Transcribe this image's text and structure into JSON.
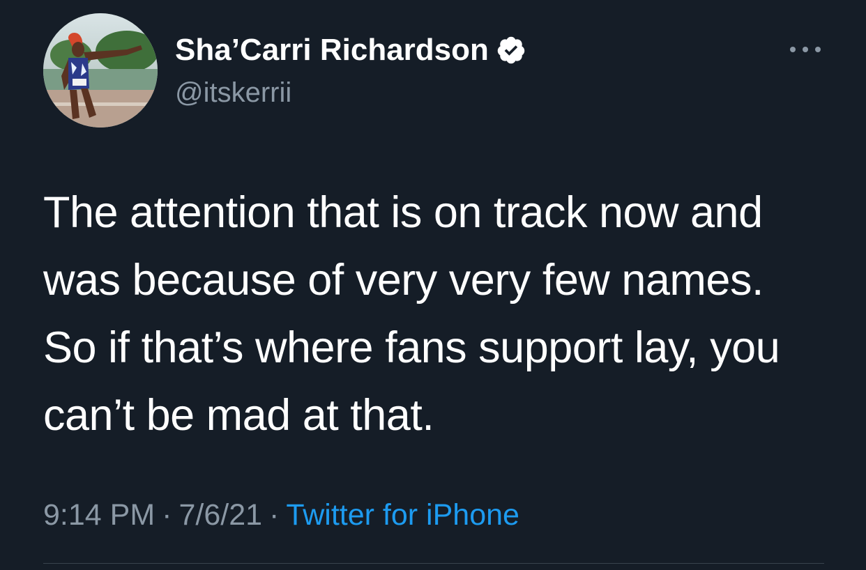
{
  "author": {
    "display_name": "Sha’Carri Richardson",
    "handle": "@itskerrii",
    "verified": true,
    "avatar_icon": "profile-photo-athlete"
  },
  "tweet": {
    "text_lines": [
      "The attention that is on track now and",
      "was because of very very few names.",
      "So if that’s where fans support lay, you",
      "can’t be mad at that."
    ],
    "time": "9:14 PM",
    "date": "7/6/21",
    "separator": "·",
    "source": "Twitter for iPhone"
  },
  "menu": {
    "icon": "more-horizontal-icon"
  },
  "colors": {
    "background": "#151d27",
    "text": "#ffffff",
    "secondary": "#8b98a5",
    "link": "#1d9bf0"
  }
}
